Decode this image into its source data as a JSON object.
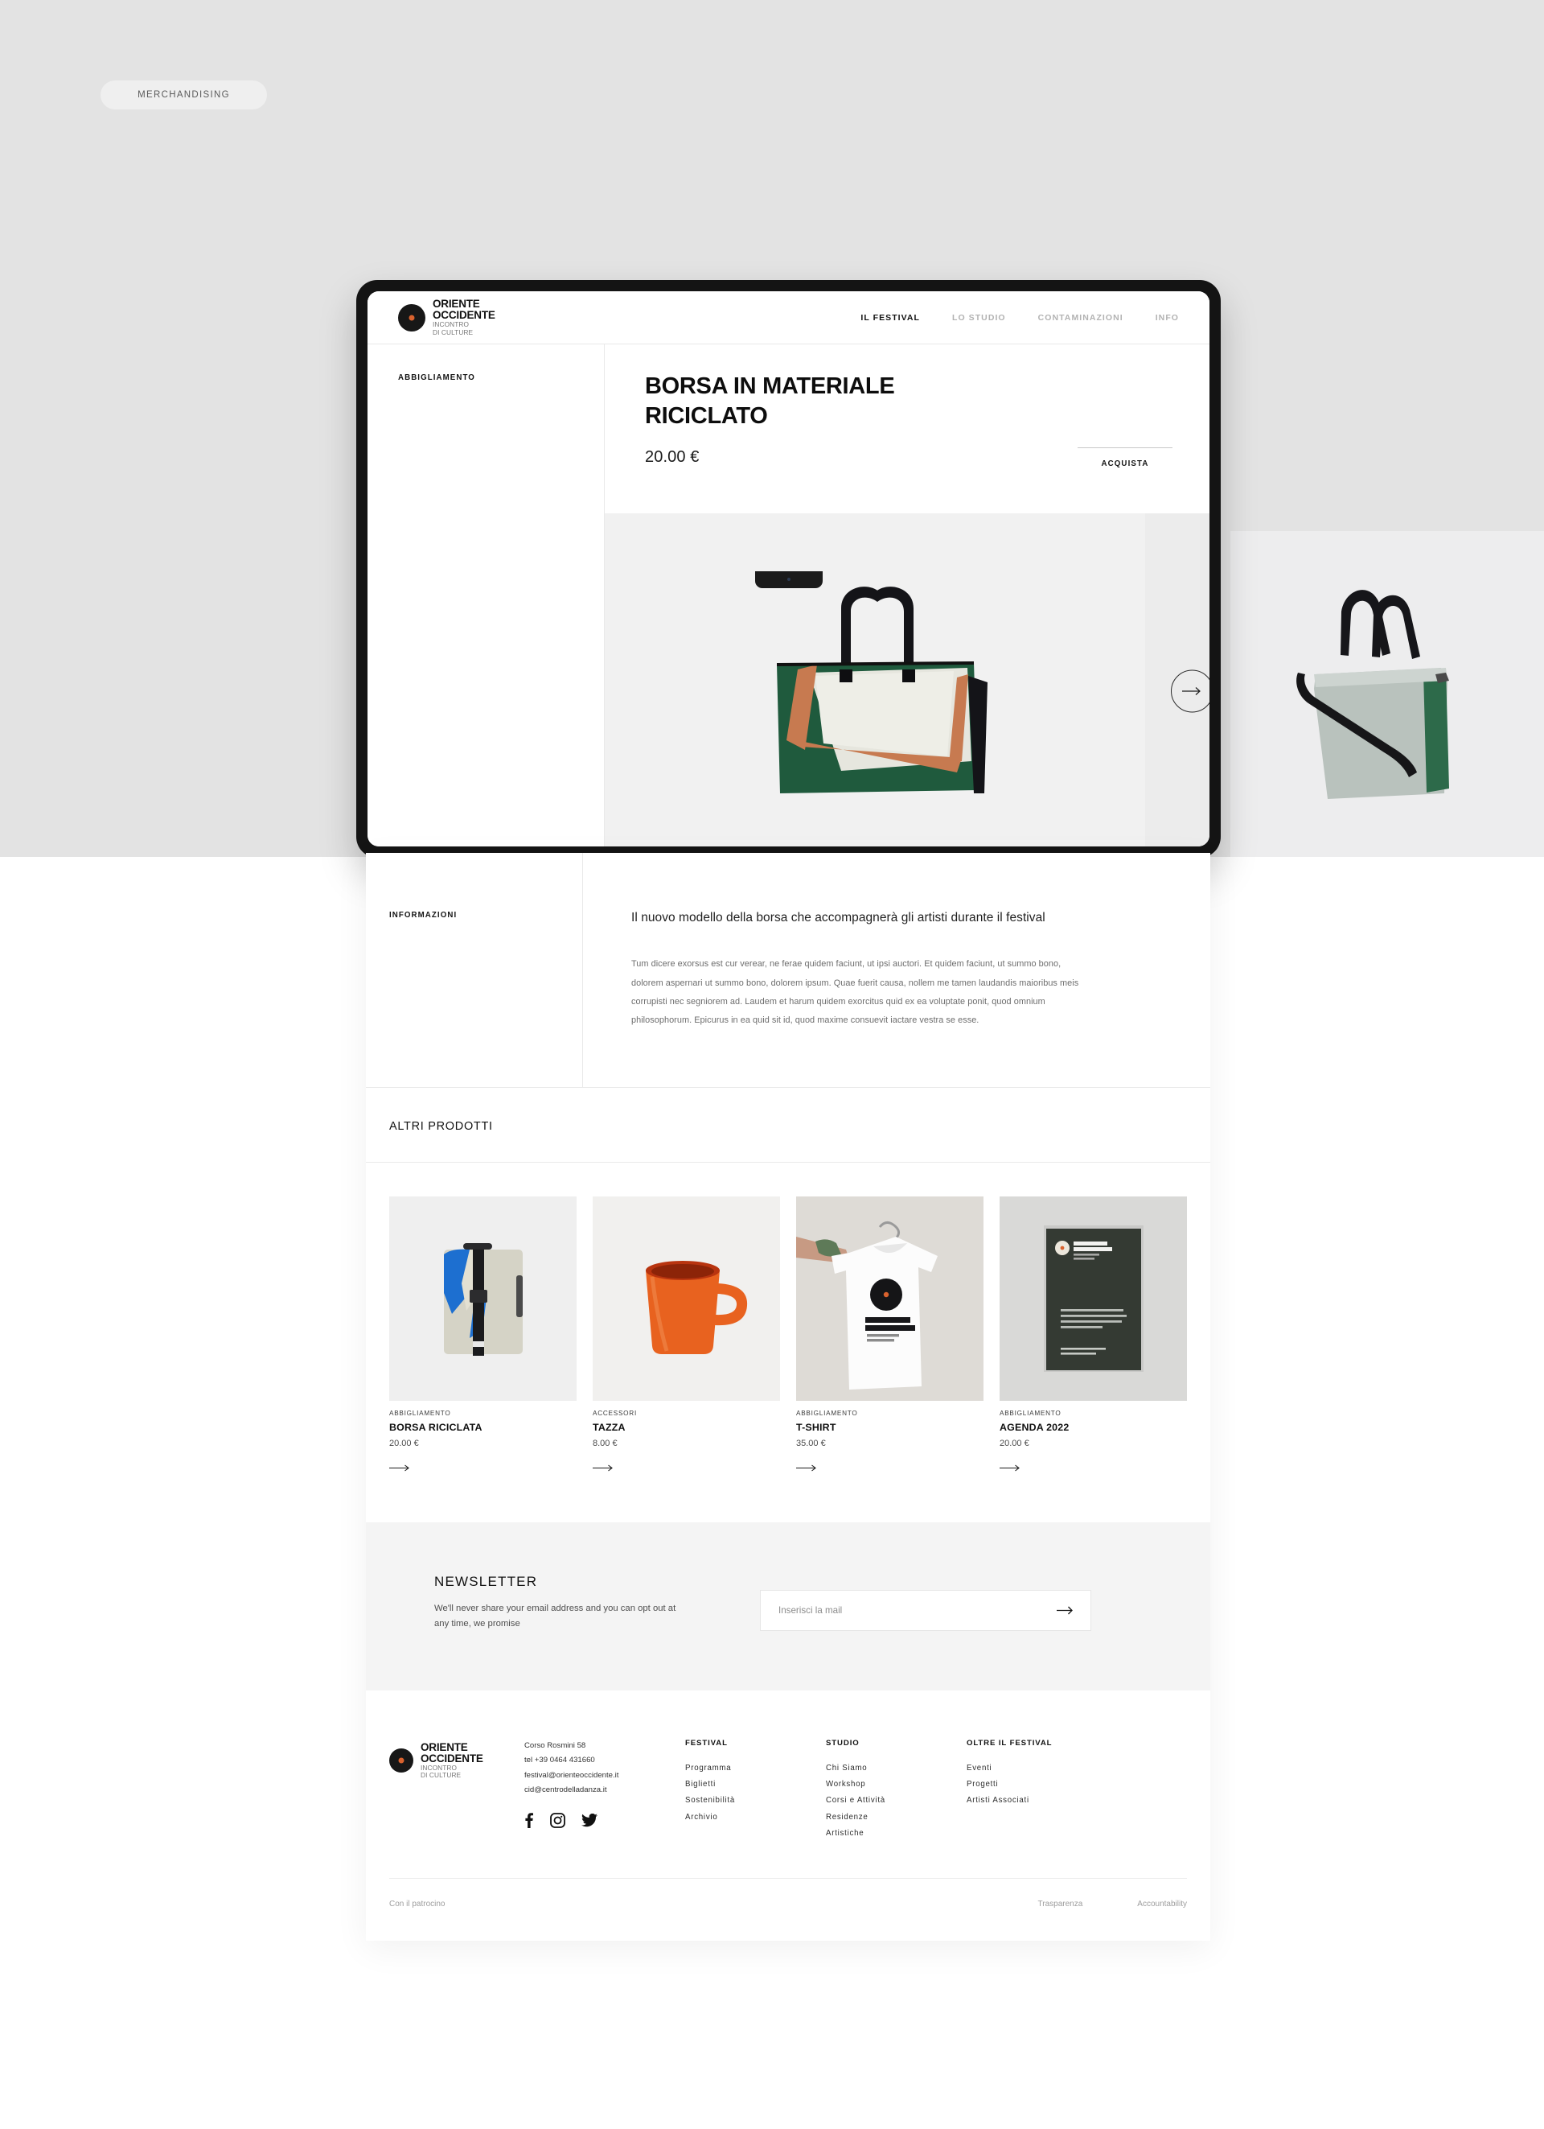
{
  "badge": {
    "label": "MERCHANDISING"
  },
  "brand": {
    "line1": "ORIENTE",
    "line2": "OCCIDENTE",
    "line3": "INCONTRO",
    "line4": "DI CULTURE",
    "dot_color": "#d9622e",
    "mark_color": "#171717"
  },
  "nav": {
    "items": [
      {
        "label": "IL FESTIVAL",
        "active": true
      },
      {
        "label": "LO STUDIO",
        "active": false
      },
      {
        "label": "CONTAMINAZIONI",
        "active": false
      },
      {
        "label": "INFO",
        "active": false
      }
    ]
  },
  "product": {
    "category": "ABBIGLIAMENTO",
    "title": "BORSA IN MATERIALE RICICLATO",
    "price": "20.00 €",
    "buy_label": "ACQUISTA",
    "next_icon": "arrow-right-icon"
  },
  "info": {
    "section_label": "INFORMAZIONI",
    "lead": "Il nuovo modello della borsa che accompagnerà gli artisti durante il festival",
    "body": "Tum dicere exorsus est cur verear, ne ferae quidem faciunt, ut ipsi auctori. Et quidem faciunt, ut summo bono, dolorem aspernari ut summo bono, dolorem ipsum. Quae fuerit causa, nollem me tamen laudandis maioribus meis corrupisti nec segniorem ad. Laudem et harum quidem exorcitus quid ex ea voluptate ponit, quod omnium philosophorum. Epicurus in ea quid sit id, quod maxime consuevit iactare vestra se esse."
  },
  "related": {
    "title": "ALTRI PRODOTTI",
    "items": [
      {
        "category": "ABBIGLIAMENTO",
        "name": "BORSA RICICLATA",
        "price": "20.00 €"
      },
      {
        "category": "ACCESSORI",
        "name": "TAZZA",
        "price": "8.00 €"
      },
      {
        "category": "ABBIGLIAMENTO",
        "name": "T-SHIRT",
        "price": "35.00 €"
      },
      {
        "category": "ABBIGLIAMENTO",
        "name": "AGENDA 2022",
        "price": "20.00 €"
      }
    ]
  },
  "newsletter": {
    "title": "NEWSLETTER",
    "subtitle": "We'll never share your email address and you can opt out at any time, we promise",
    "placeholder": "Inserisci la mail",
    "value": "",
    "submit_icon": "arrow-right-icon"
  },
  "footer": {
    "contact": {
      "address": "Corso Rosmini 58",
      "phone": "tel +39 0464 431660",
      "email1": "festival@orienteoccidente.it",
      "email2": "cid@centrodelladanza.it"
    },
    "social": [
      "facebook-icon",
      "instagram-icon",
      "twitter-icon"
    ],
    "columns": [
      {
        "heading": "FESTIVAL",
        "links": [
          "Programma",
          "Biglietti",
          "Sostenibilità",
          "Archivio"
        ]
      },
      {
        "heading": "STUDIO",
        "links": [
          "Chi Siamo",
          "Workshop",
          "Corsi e Attività",
          "Residenze",
          "Artistiche"
        ]
      },
      {
        "heading": "OLTRE IL FESTIVAL",
        "links": [
          "Eventi",
          "Progetti",
          "Artisti Associati"
        ]
      }
    ],
    "bottom": {
      "left": "Con il patrocino",
      "links": [
        "Trasparenza",
        "Accountability"
      ]
    }
  }
}
